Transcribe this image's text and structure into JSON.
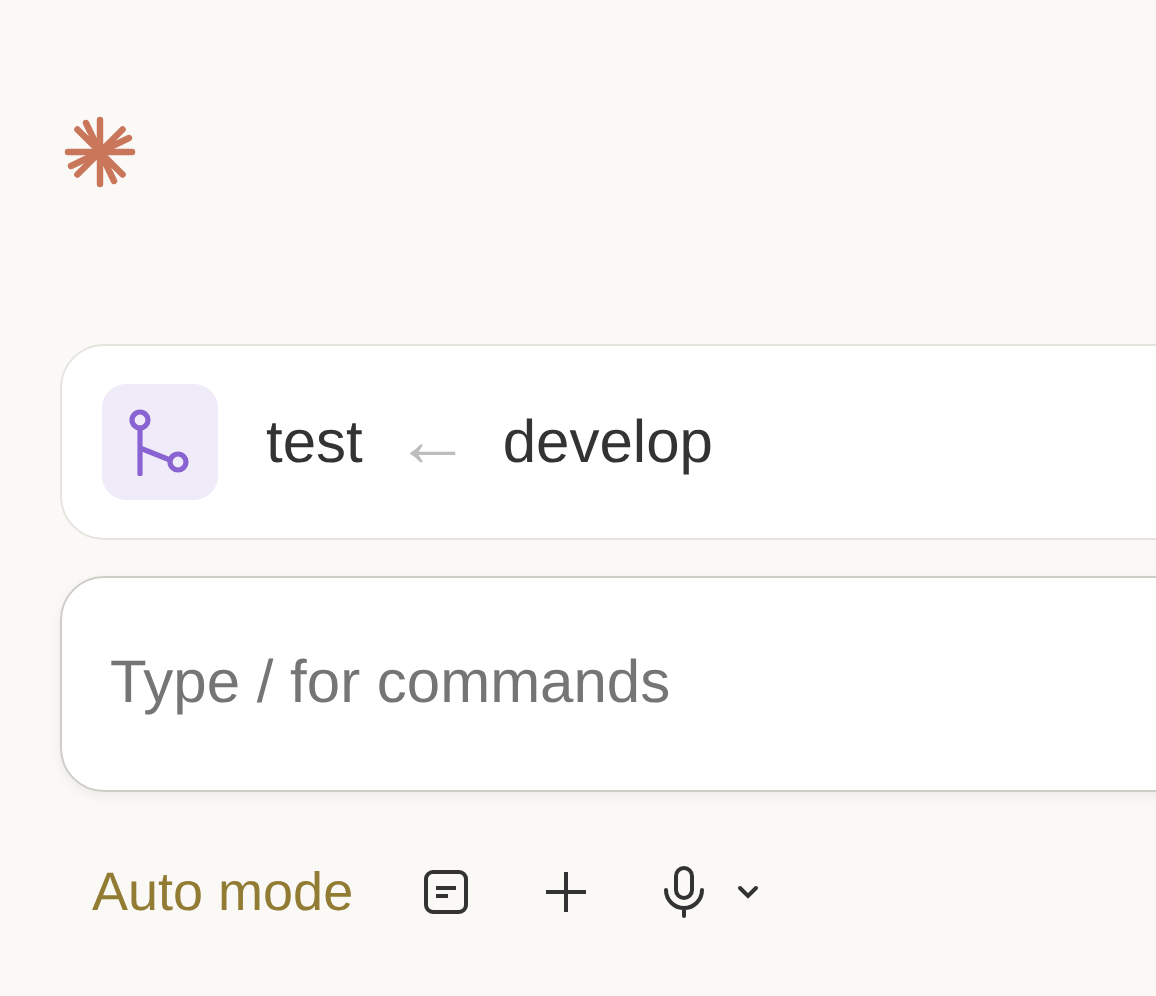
{
  "branch": {
    "target": "test",
    "arrow": "←",
    "source": "develop"
  },
  "composer": {
    "placeholder": "Type / for commands"
  },
  "toolbar": {
    "mode": "Auto mode"
  }
}
